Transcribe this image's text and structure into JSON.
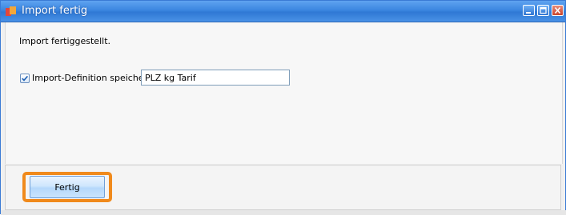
{
  "window": {
    "title": "Import fertig",
    "icon": "app-icon",
    "controls": [
      "minimize-icon",
      "maximize-icon",
      "close-icon"
    ]
  },
  "content": {
    "message": "Import fertiggestellt.",
    "save_definition": {
      "checked": true,
      "label": "Import-Definition speichern",
      "value": "PLZ kg Tarif"
    }
  },
  "footer": {
    "finish_label": "Fertig"
  },
  "colors": {
    "titlebar": "#3b86e0",
    "focus_highlight": "#f08a1c",
    "button_face": "#cfe6fd"
  }
}
